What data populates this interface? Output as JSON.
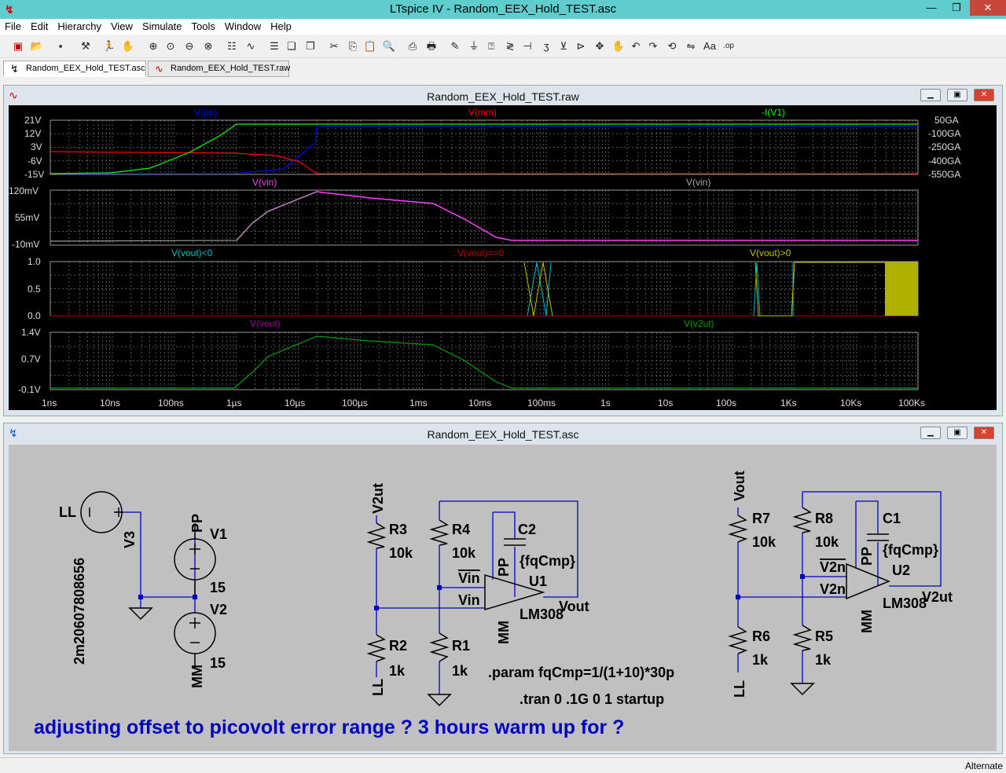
{
  "window": {
    "title": "LTspice IV - Random_EEX_Hold_TEST.asc"
  },
  "menu": [
    "File",
    "Edit",
    "Hierarchy",
    "View",
    "Simulate",
    "Tools",
    "Window",
    "Help"
  ],
  "tabs": [
    {
      "label": "Random_EEX_Hold_TEST.asc",
      "active": true
    },
    {
      "label": "Random_EEX_Hold_TEST.raw",
      "active": false
    }
  ],
  "waveform_window": {
    "title": "Random_EEX_Hold_TEST.raw"
  },
  "schematic_window": {
    "title": "Random_EEX_Hold_TEST.asc"
  },
  "status": {
    "right": "Alternate"
  },
  "chart_data": [
    {
      "type": "line",
      "pane": 1,
      "series": [
        {
          "name": "V(pp)",
          "color": "#0000ff",
          "x": [
            "1ns",
            "1µs",
            "5µs",
            "10µs",
            "20µs",
            "100Ks"
          ],
          "values": [
            -15,
            -15,
            -14,
            -8,
            15,
            15
          ]
        },
        {
          "name": "V(mm)",
          "color": "#ff0000",
          "x": [
            "1ns",
            "1µs",
            "5µs",
            "10µs",
            "20µs",
            "100Ks"
          ],
          "values": [
            -12,
            -12,
            -12,
            -16,
            -25,
            -25
          ]
        },
        {
          "name": "-I(V1)",
          "color": "#00ff00",
          "x": [
            "1ns",
            "10ns",
            "100ns",
            "1µs",
            "2µs",
            "100Ks"
          ],
          "values": [
            -15,
            -15,
            -9,
            15,
            21,
            21
          ]
        }
      ],
      "yticks_left": [
        "21V",
        "12V",
        "3V",
        "-6V",
        "-15V"
      ],
      "yticks_right": [
        "50GA",
        "-100GA",
        "-250GA",
        "-400GA",
        "-550GA"
      ],
      "ylim": [
        -15,
        21
      ]
    },
    {
      "type": "line",
      "pane": 2,
      "series": [
        {
          "name": "V(vin)",
          "color": "#ff40ff",
          "x": [
            "1ns",
            "1µs",
            "5µs",
            "20µs",
            "2ms",
            "20ms",
            "100Ks"
          ],
          "values": [
            -10,
            -10,
            55,
            120,
            90,
            -10,
            -10
          ]
        },
        {
          "name": "V(vin)",
          "color": "#808080",
          "x": [
            "1ns",
            "1µs",
            "5µs",
            "20µs"
          ],
          "values": [
            -10,
            -10,
            55,
            120
          ]
        }
      ],
      "yticks": [
        "120mV",
        "55mV",
        "-10mV"
      ],
      "ylim": [
        -10,
        120
      ]
    },
    {
      "type": "line",
      "pane": 3,
      "series": [
        {
          "name": "V(vout)<0",
          "color": "#00c0c0"
        },
        {
          "name": "V(vout)==0",
          "color": "#c00000"
        },
        {
          "name": "V(vout)>0",
          "color": "#c0c000"
        }
      ],
      "yticks": [
        "1.0",
        "0.5",
        "0.0"
      ],
      "ylim": [
        0,
        1
      ]
    },
    {
      "type": "line",
      "pane": 4,
      "series": [
        {
          "name": "V(vout)",
          "color": "#a000a0"
        },
        {
          "name": "V(v2ut)",
          "color": "#00a000",
          "x": [
            "1ns",
            "1µs",
            "5µs",
            "20µs",
            "2ms",
            "30ms",
            "100Ks"
          ],
          "values": [
            -0.1,
            -0.1,
            0.8,
            1.35,
            1.05,
            -0.1,
            -0.1
          ]
        }
      ],
      "yticks": [
        "1.4V",
        "0.7V",
        "-0.1V"
      ],
      "ylim": [
        -0.1,
        1.4
      ]
    }
  ],
  "xticks": [
    "1ns",
    "10ns",
    "100ns",
    "1µs",
    "10µs",
    "100µs",
    "1ms",
    "10ms",
    "100ms",
    "1s",
    "10s",
    "100s",
    "1Ks",
    "10Ks",
    "100Ks"
  ],
  "schematic": {
    "labels": {
      "ll1": "LL",
      "v3": "V3",
      "v3val": "2m20607808656",
      "pp1": "PP",
      "v1": "V1",
      "v1val": "15",
      "v2": "V2",
      "v2val": "15",
      "mm1": "MM",
      "v2ut_in": "V2ut",
      "r3": "R3",
      "r3v": "10k",
      "r4": "R4",
      "r4v": "10k",
      "c2": "C2",
      "c2v": "{fqCmp}",
      "u1": "U1",
      "lm1": "LM308",
      "pp2": "PP",
      "mm2": "MM",
      "vin_m": "Vin",
      "vin_p": "Vin",
      "vout1": "Vout",
      "r2": "R2",
      "r2v": "1k",
      "r1": "R1",
      "r1v": "1k",
      "ll2": "LL",
      "vout_in": "Vout",
      "r7": "R7",
      "r7v": "10k",
      "r8": "R8",
      "r8v": "10k",
      "c1": "C1",
      "c1v": "{fqCmp}",
      "u2": "U2",
      "lm2": "LM308",
      "pp3": "PP",
      "mm3": "MM",
      "v2n_m": "V2n",
      "v2n_p": "V2n",
      "v2ut_out": "V2ut",
      "r6": "R6",
      "r6v": "1k",
      "r5": "R5",
      "r5v": "1k",
      "ll3": "LL"
    },
    "param": ".param fqCmp=1/(1+10)*30p",
    "tran": ".tran 0 .1G 0 1 startup",
    "comment": "adjusting offset to picovolt error range ? 3 hours warm up for ?"
  }
}
